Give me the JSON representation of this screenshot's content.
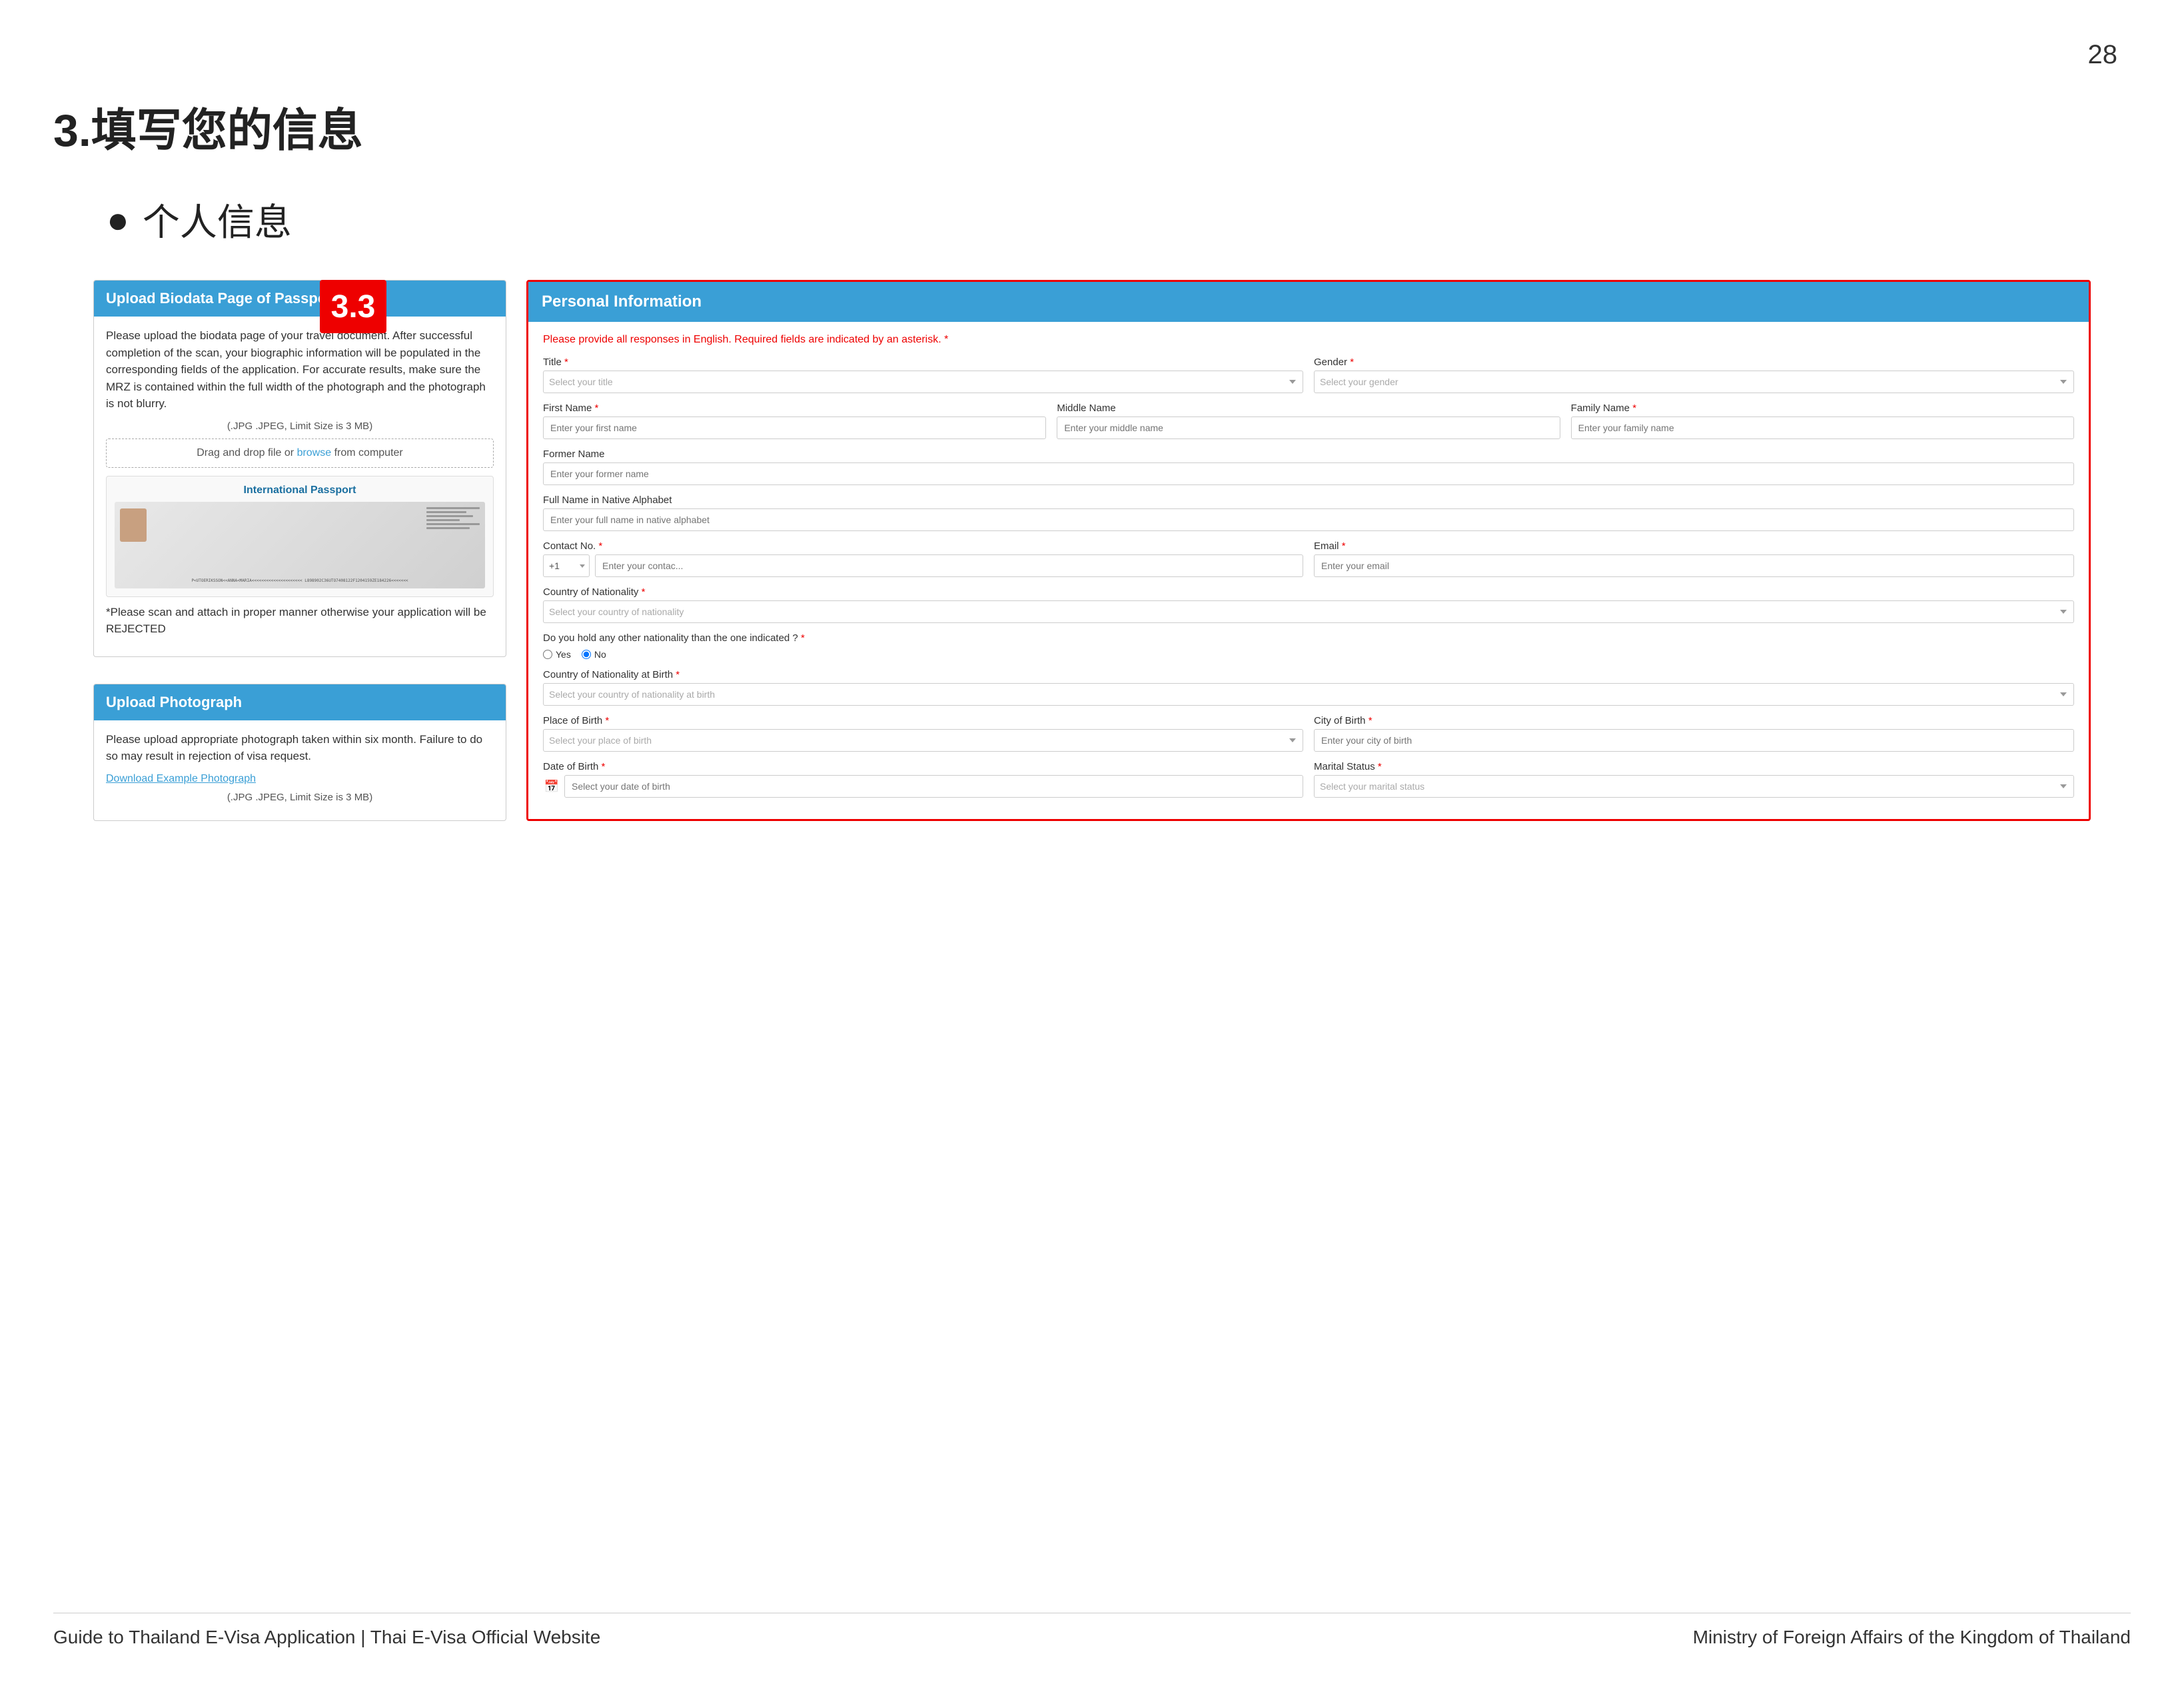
{
  "page": {
    "number": "28",
    "section_title": "3.填写您的信息",
    "bullet": "个人信息"
  },
  "left_panel": {
    "biodata_header": "Upload Biodata Page of Passport",
    "biodata_body": "Please upload the biodata page of your travel document. After successful completion of the scan, your biographic information will be populated in the corresponding fields of the application. For accurate results, make sure the MRZ is contained within the full width of the photograph and the photograph is not blurry.",
    "file_info": "(.JPG .JPEG, Limit Size is 3 MB)",
    "drag_drop_text": "Drag and drop file or",
    "drag_drop_link": "browse",
    "drag_drop_suffix": "from computer",
    "passport_title": "International Passport",
    "passport_mrz": "P<UTOERIKSSON<<ANNA<MARIA<<<<<<<<<<<<<<<<<<<<<\nL898902C36UTO7408122F1204159ZE184226<<<<<<<",
    "warning_text": "*Please scan and attach in proper manner otherwise your application will be REJECTED",
    "photo_header": "Upload Photograph",
    "photo_body": "Please upload appropriate photograph taken within six month. Failure to do so may result in rejection of visa request.",
    "download_link": "Download Example Photograph",
    "photo_file_info": "(.JPG .JPEG, Limit Size is 3 MB)",
    "number_badge": "3.3"
  },
  "right_panel": {
    "header": "Personal Information",
    "instruction": "Please provide all responses in English. Required fields are indicated by an asterisk.",
    "instruction_asterisk": "*",
    "fields": {
      "title_label": "Title",
      "title_required": "*",
      "title_placeholder": "Select your title",
      "gender_label": "Gender",
      "gender_required": "*",
      "gender_placeholder": "Select your gender",
      "first_name_label": "First Name",
      "first_name_required": "*",
      "first_name_placeholder": "Enter your first name",
      "middle_name_label": "Middle Name",
      "middle_name_placeholder": "Enter your middle name",
      "family_name_label": "Family Name",
      "family_name_required": "*",
      "family_name_placeholder": "Enter your family name",
      "former_name_label": "Former Name",
      "former_name_placeholder": "Enter your former name",
      "full_name_native_label": "Full Name in Native Alphabet",
      "full_name_native_placeholder": "Enter your full name in native alphabet",
      "contact_label": "Contact No.",
      "contact_required": "*",
      "phone_prefix": "+1",
      "contact_placeholder": "Enter your contac...",
      "email_label": "Email",
      "email_required": "*",
      "email_placeholder": "Enter your email",
      "nationality_label": "Country of Nationality",
      "nationality_required": "*",
      "nationality_placeholder": "Select your country of nationality",
      "other_nationality_question": "Do you hold any other nationality than the one indicated ?",
      "other_nationality_required": "*",
      "radio_yes": "Yes",
      "radio_no": "No",
      "nationality_birth_label": "Country of Nationality at Birth",
      "nationality_birth_required": "*",
      "nationality_birth_placeholder": "Select your country of nationality at birth",
      "place_of_birth_label": "Place of Birth",
      "place_of_birth_required": "*",
      "place_of_birth_placeholder": "Select your place of birth",
      "city_of_birth_label": "City of Birth",
      "city_of_birth_required": "*",
      "city_of_birth_placeholder": "Enter your city of birth",
      "date_of_birth_label": "Date of Birth",
      "date_of_birth_required": "*",
      "date_of_birth_placeholder": "Select your date of birth",
      "marital_status_label": "Marital Status",
      "marital_status_required": "*",
      "marital_status_placeholder": "Select your marital status"
    }
  },
  "footer": {
    "left": "Guide to Thailand E-Visa Application | Thai E-Visa Official Website",
    "right": "Ministry of Foreign Affairs of the Kingdom of Thailand"
  }
}
